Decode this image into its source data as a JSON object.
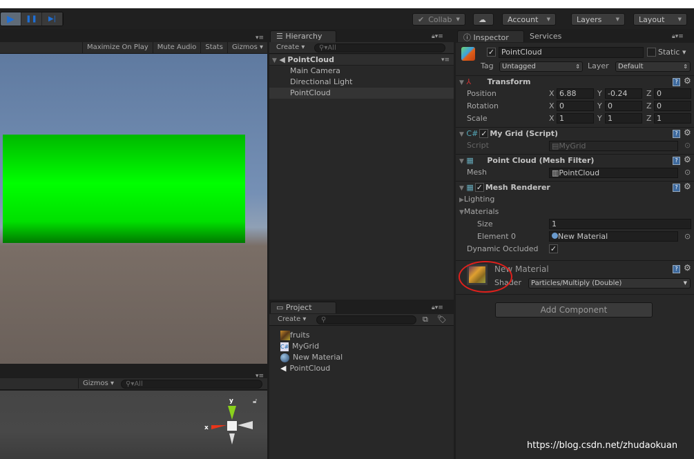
{
  "toolbar": {
    "play": "▶",
    "pause": "❚❚",
    "step": "▶|",
    "collab": "Collab",
    "cloud_icon": "cloud-icon",
    "account": "Account",
    "layers": "Layers",
    "layout": "Layout"
  },
  "game": {
    "maximize": "Maximize On Play",
    "mute": "Mute Audio",
    "stats": "Stats",
    "gizmos": "Gizmos",
    "colors": {
      "sky": "#6c86ab",
      "ground": "#6a605a",
      "plane": "#00e000"
    }
  },
  "scene": {
    "gizmos": "Gizmos",
    "search_placeholder": "All",
    "axis_x": "x",
    "axis_y": "y"
  },
  "hierarchy": {
    "tab": "Hierarchy",
    "create": "Create",
    "search_placeholder": "All",
    "scene": "PointCloud",
    "items": [
      "Main Camera",
      "Directional Light",
      "PointCloud"
    ]
  },
  "project": {
    "tab": "Project",
    "create": "Create",
    "items": [
      {
        "name": "fruits",
        "icon": "texture-icon"
      },
      {
        "name": "MyGrid",
        "icon": "csharp-script-icon"
      },
      {
        "name": "New Material",
        "icon": "material-sphere-icon"
      },
      {
        "name": "PointCloud",
        "icon": "unity-scene-icon"
      }
    ]
  },
  "inspector": {
    "tab": "Inspector",
    "services_tab": "Services",
    "object_name": "PointCloud",
    "static": "Static",
    "tag_label": "Tag",
    "tag": "Untagged",
    "layer_label": "Layer",
    "layer": "Default",
    "transform": {
      "title": "Transform",
      "position": "Position",
      "rotation": "Rotation",
      "scale": "Scale",
      "x": "X",
      "y": "Y",
      "z": "Z",
      "pos": [
        "6.88",
        "-0.24",
        "0"
      ],
      "rot": [
        "0",
        "0",
        "0"
      ],
      "scl": [
        "1",
        "1",
        "1"
      ]
    },
    "mygrid": {
      "title": "My Grid (Script)",
      "script_label": "Script",
      "script": "MyGrid"
    },
    "meshfilter": {
      "title": "Point Cloud (Mesh Filter)",
      "mesh_label": "Mesh",
      "mesh": "PointCloud"
    },
    "renderer": {
      "title": "Mesh Renderer",
      "lighting": "Lighting",
      "materials": "Materials",
      "size_label": "Size",
      "size": "1",
      "element_label": "Element 0",
      "element": "New Material",
      "dynamic": "Dynamic Occluded"
    },
    "material": {
      "name": "New Material",
      "shader_label": "Shader",
      "shader": "Particles/Multiply (Double)",
      "annotation_color": "#e0201c"
    },
    "add_component": "Add Component"
  },
  "watermark": "https://blog.csdn.net/zhudaokuan"
}
